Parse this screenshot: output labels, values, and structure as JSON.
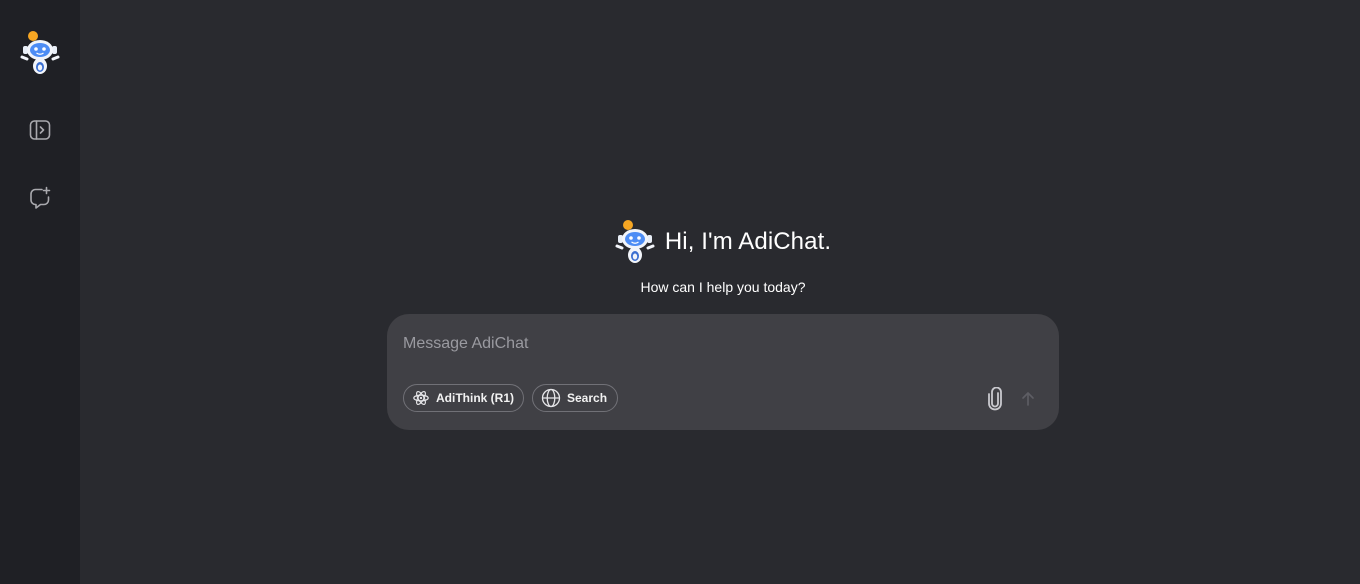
{
  "app": {
    "name": "AdiChat"
  },
  "sidebar": {
    "logo_icon": "robot-mascot-icon",
    "items": [
      {
        "icon": "sidebar-toggle-icon"
      },
      {
        "icon": "new-chat-icon"
      }
    ]
  },
  "hero": {
    "title": "Hi, I'm AdiChat.",
    "subtitle": "How can I help you today?",
    "icon": "robot-mascot-icon"
  },
  "composer": {
    "placeholder": "Message AdiChat",
    "value": "",
    "think_label": "AdiThink (R1)",
    "think_icon": "atom-icon",
    "search_label": "Search",
    "search_icon": "globe-icon",
    "attach_icon": "paperclip-icon",
    "send_icon": "arrow-up-icon"
  },
  "colors": {
    "background": "#292a2f",
    "sidebar": "#1f2025",
    "composer": "#404045",
    "accent_blue": "#4d8df5"
  }
}
